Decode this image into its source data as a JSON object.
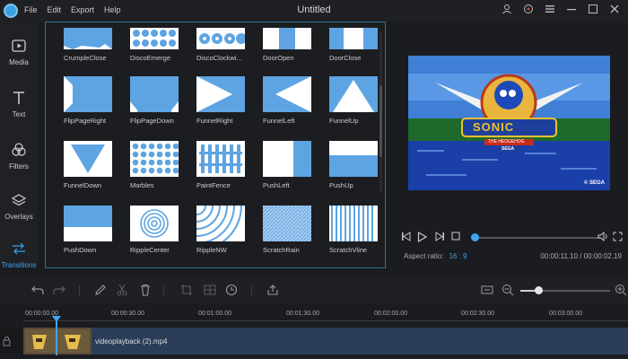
{
  "menu": [
    "File",
    "Edit",
    "Export",
    "Help"
  ],
  "title": "Untitled",
  "nav": [
    {
      "label": "Media",
      "icon": "media-icon",
      "active": false
    },
    {
      "label": "Text",
      "icon": "text-icon",
      "active": false
    },
    {
      "label": "Filters",
      "icon": "filters-icon",
      "active": false
    },
    {
      "label": "Overlays",
      "icon": "overlays-icon",
      "active": false
    },
    {
      "label": "Transitions",
      "icon": "transitions-icon",
      "active": true
    }
  ],
  "transitions": [
    [
      "CrumpleClose",
      "DiscoEmerge",
      "DiscoClockwi...",
      "DoorOpen",
      "DoorClose"
    ],
    [
      "FlipPageRight",
      "FlipPageDown",
      "FunnelRight",
      "FunnelLeft",
      "FunnelUp"
    ],
    [
      "FunnelDown",
      "Marbles",
      "PaintFence",
      "PushLeft",
      "PushUp"
    ],
    [
      "PushDown",
      "RippleCenter",
      "RippleNW",
      "ScratchRain",
      "ScratchVline"
    ]
  ],
  "preview": {
    "aspect_label": "Aspect ratio:",
    "aspect_value": "16 : 9",
    "time": "00:00:11.10 / 00:00:02.19",
    "progress": 0.02
  },
  "timeline": {
    "ticks": [
      "00:00:00.00",
      "00:00:30.00",
      "00:01:00.00",
      "00:01:30.00",
      "00:02:00.00",
      "00:02:30.00",
      "00:03:00.00"
    ],
    "clip_name": "videoplayback (2).mp4",
    "zoom_level": 0.2
  },
  "colors": {
    "accent": "#3ea5f0",
    "thumb_blue": "#5ea4e2",
    "panel_border": "#2f6fa0"
  }
}
